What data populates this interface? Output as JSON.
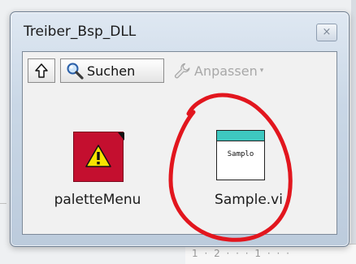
{
  "window": {
    "title": "Treiber_Bsp_DLL",
    "close_glyph": "×"
  },
  "toolbar": {
    "up_icon": "arrow-up-icon",
    "search_label": "Suchen",
    "customize_label": "Anpassen",
    "customize_dropdown": "▾"
  },
  "items": [
    {
      "label": "paletteMenu",
      "icon": "warning-icon"
    },
    {
      "label": "Sample.vi",
      "icon_text": "Samplo"
    }
  ],
  "background": {
    "ruler_text": "1 · 2 · · · 1 · · ·"
  },
  "colors": {
    "palette_icon_bg": "#c40f2f",
    "sample_icon_bar": "#3ec8c0",
    "annotation_circle": "#e2161e"
  }
}
